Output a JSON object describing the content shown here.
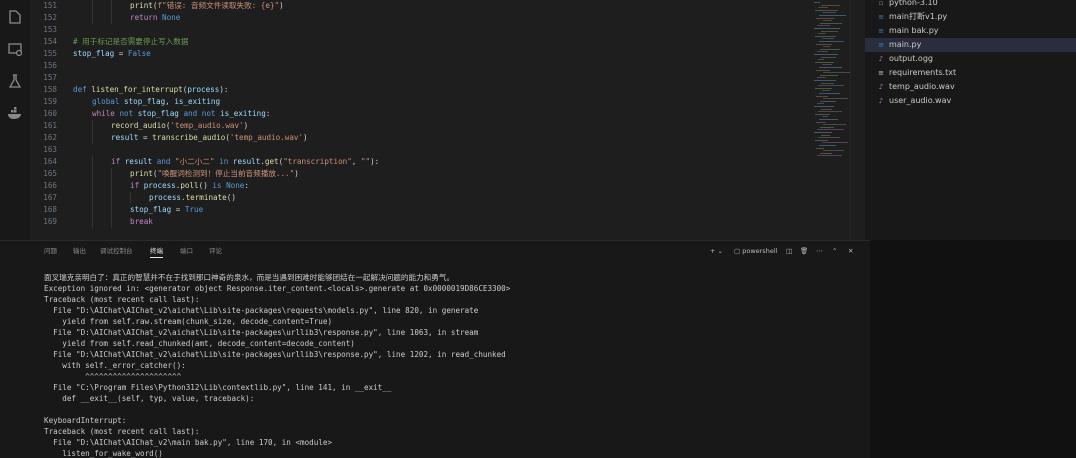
{
  "editor": {
    "lines": [
      {
        "n": "151",
        "indent": 3,
        "tokens": [
          [
            "fn",
            "print"
          ],
          [
            "pl",
            "("
          ],
          [
            "str",
            "f\"错误: 音频文件读取失败: {e}\""
          ],
          [
            "pl",
            ")"
          ]
        ]
      },
      {
        "n": "152",
        "indent": 3,
        "tokens": [
          [
            "kw",
            "return"
          ],
          [
            "pl",
            " "
          ],
          [
            "kw2",
            "None"
          ]
        ]
      },
      {
        "n": "153",
        "indent": 0,
        "tokens": []
      },
      {
        "n": "154",
        "indent": 0,
        "tokens": [
          [
            "cm",
            "# 用于标记是否需要停止写入数据"
          ]
        ]
      },
      {
        "n": "155",
        "indent": 0,
        "tokens": [
          [
            "var",
            "stop_flag"
          ],
          [
            "pl",
            " = "
          ],
          [
            "kw2",
            "False"
          ]
        ]
      },
      {
        "n": "156",
        "indent": 0,
        "tokens": []
      },
      {
        "n": "157",
        "indent": 0,
        "tokens": []
      },
      {
        "n": "158",
        "indent": 0,
        "tokens": [
          [
            "kw2",
            "def"
          ],
          [
            "pl",
            " "
          ],
          [
            "fn",
            "listen_for_interrupt"
          ],
          [
            "pl",
            "("
          ],
          [
            "var",
            "process"
          ],
          [
            "pl",
            "):"
          ]
        ]
      },
      {
        "n": "159",
        "indent": 1,
        "tokens": [
          [
            "kw2",
            "global"
          ],
          [
            "pl",
            " "
          ],
          [
            "var",
            "stop_flag"
          ],
          [
            "pl",
            ", "
          ],
          [
            "var",
            "is_exiting"
          ]
        ]
      },
      {
        "n": "160",
        "indent": 1,
        "tokens": [
          [
            "kw",
            "while"
          ],
          [
            "pl",
            " "
          ],
          [
            "kw2",
            "not"
          ],
          [
            "pl",
            " "
          ],
          [
            "var",
            "stop_flag"
          ],
          [
            "pl",
            " "
          ],
          [
            "kw2",
            "and"
          ],
          [
            "pl",
            " "
          ],
          [
            "kw2",
            "not"
          ],
          [
            "pl",
            " "
          ],
          [
            "var",
            "is_exiting"
          ],
          [
            "pl",
            ":"
          ]
        ]
      },
      {
        "n": "161",
        "indent": 2,
        "tokens": [
          [
            "fn",
            "record_audio"
          ],
          [
            "pl",
            "("
          ],
          [
            "str",
            "'temp_audio.wav'"
          ],
          [
            "pl",
            ")"
          ]
        ]
      },
      {
        "n": "162",
        "indent": 2,
        "tokens": [
          [
            "var",
            "result"
          ],
          [
            "pl",
            " = "
          ],
          [
            "fn",
            "transcribe_audio"
          ],
          [
            "pl",
            "("
          ],
          [
            "str",
            "'temp_audio.wav'"
          ],
          [
            "pl",
            ")"
          ]
        ]
      },
      {
        "n": "163",
        "indent": 0,
        "tokens": []
      },
      {
        "n": "164",
        "indent": 2,
        "tokens": [
          [
            "kw",
            "if"
          ],
          [
            "pl",
            " "
          ],
          [
            "var",
            "result"
          ],
          [
            "pl",
            " "
          ],
          [
            "kw2",
            "and"
          ],
          [
            "pl",
            " "
          ],
          [
            "str",
            "\"小二小二\""
          ],
          [
            "pl",
            " "
          ],
          [
            "kw2",
            "in"
          ],
          [
            "pl",
            " "
          ],
          [
            "var",
            "result"
          ],
          [
            "pl",
            "."
          ],
          [
            "fn",
            "get"
          ],
          [
            "pl",
            "("
          ],
          [
            "str",
            "\"transcription\""
          ],
          [
            "pl",
            ", "
          ],
          [
            "str",
            "\"\""
          ],
          [
            "pl",
            "):"
          ]
        ]
      },
      {
        "n": "165",
        "indent": 3,
        "tokens": [
          [
            "fn",
            "print"
          ],
          [
            "pl",
            "("
          ],
          [
            "str",
            "\"唤醒词检测到！停止当前音频播放...\""
          ],
          [
            "pl",
            ")"
          ]
        ]
      },
      {
        "n": "166",
        "indent": 3,
        "tokens": [
          [
            "kw",
            "if"
          ],
          [
            "pl",
            " "
          ],
          [
            "var",
            "process"
          ],
          [
            "pl",
            "."
          ],
          [
            "fn",
            "poll"
          ],
          [
            "pl",
            "() "
          ],
          [
            "kw2",
            "is"
          ],
          [
            "pl",
            " "
          ],
          [
            "kw2",
            "None"
          ],
          [
            "pl",
            ":"
          ]
        ]
      },
      {
        "n": "167",
        "indent": 4,
        "tokens": [
          [
            "var",
            "process"
          ],
          [
            "pl",
            "."
          ],
          [
            "fn",
            "terminate"
          ],
          [
            "pl",
            "()"
          ]
        ]
      },
      {
        "n": "168",
        "indent": 3,
        "tokens": [
          [
            "var",
            "stop_flag"
          ],
          [
            "pl",
            " = "
          ],
          [
            "kw2",
            "True"
          ]
        ]
      },
      {
        "n": "169",
        "indent": 3,
        "tokens": [
          [
            "kw",
            "break"
          ]
        ]
      }
    ]
  },
  "activity_icons": [
    "files-icon",
    "search-icon",
    "remote-explorer-icon",
    "testing-icon",
    "docker-icon"
  ],
  "explorer": {
    "files": [
      {
        "name": "python-3.10",
        "icon": "file-icon",
        "color": "#8a8a8a",
        "active": false
      },
      {
        "name": "main打断v1.py",
        "icon": "python-file-icon",
        "color": "#3b82c4",
        "active": false
      },
      {
        "name": "main bak.py",
        "icon": "python-file-icon",
        "color": "#3b82c4",
        "active": false
      },
      {
        "name": "main.py",
        "icon": "python-file-icon",
        "color": "#3b82c4",
        "active": true
      },
      {
        "name": "output.ogg",
        "icon": "audio-file-icon",
        "color": "#c87bd6",
        "active": false
      },
      {
        "name": "requirements.txt",
        "icon": "text-file-icon",
        "color": "#cccccc",
        "active": false
      },
      {
        "name": "temp_audio.wav",
        "icon": "audio-file-icon",
        "color": "#c87bd6",
        "active": false
      },
      {
        "name": "user_audio.wav",
        "icon": "audio-file-icon",
        "color": "#c87bd6",
        "active": false
      }
    ]
  },
  "panel": {
    "tabs": [
      "问题",
      "输出",
      "调试控制台",
      "终端",
      "端口",
      "评论"
    ],
    "active_tab": 3,
    "shell_label": "powershell",
    "terminal_lines": [
      "面叉瑞克亲明白了：真正的智慧并不在于找到那口神奇的泉水，而是当遇到困难时能够团结在一起解决问题的能力和勇气。",
      "Exception ignored in: <generator object Response.iter_content.<locals>.generate at 0x0000019D86CE3300>",
      "Traceback (most recent call last):",
      "  File \"D:\\AIChat\\AIChat_v2\\aichat\\Lib\\site-packages\\requests\\models.py\", line 820, in generate",
      "    yield from self.raw.stream(chunk_size, decode_content=True)",
      "  File \"D:\\AIChat\\AIChat_v2\\aichat\\Lib\\site-packages\\urllib3\\response.py\", line 1063, in stream",
      "    yield from self.read_chunked(amt, decode_content=decode_content)",
      "  File \"D:\\AIChat\\AIChat_v2\\aichat\\Lib\\site-packages\\urllib3\\response.py\", line 1202, in read_chunked",
      "    with self._error_catcher():",
      "         ^^^^^^^^^^^^^^^^^^^^^",
      "  File \"C:\\Program Files\\Python312\\Lib\\contextlib.py\", line 141, in __exit__",
      "    def __exit__(self, typ, value, traceback):",
      "",
      "KeyboardInterrupt:",
      "Traceback (most recent call last):",
      "  File \"D:\\AIChat\\AIChat_v2\\main bak.py\", line 170, in <module>",
      "    listen_for_wake_word()"
    ]
  }
}
